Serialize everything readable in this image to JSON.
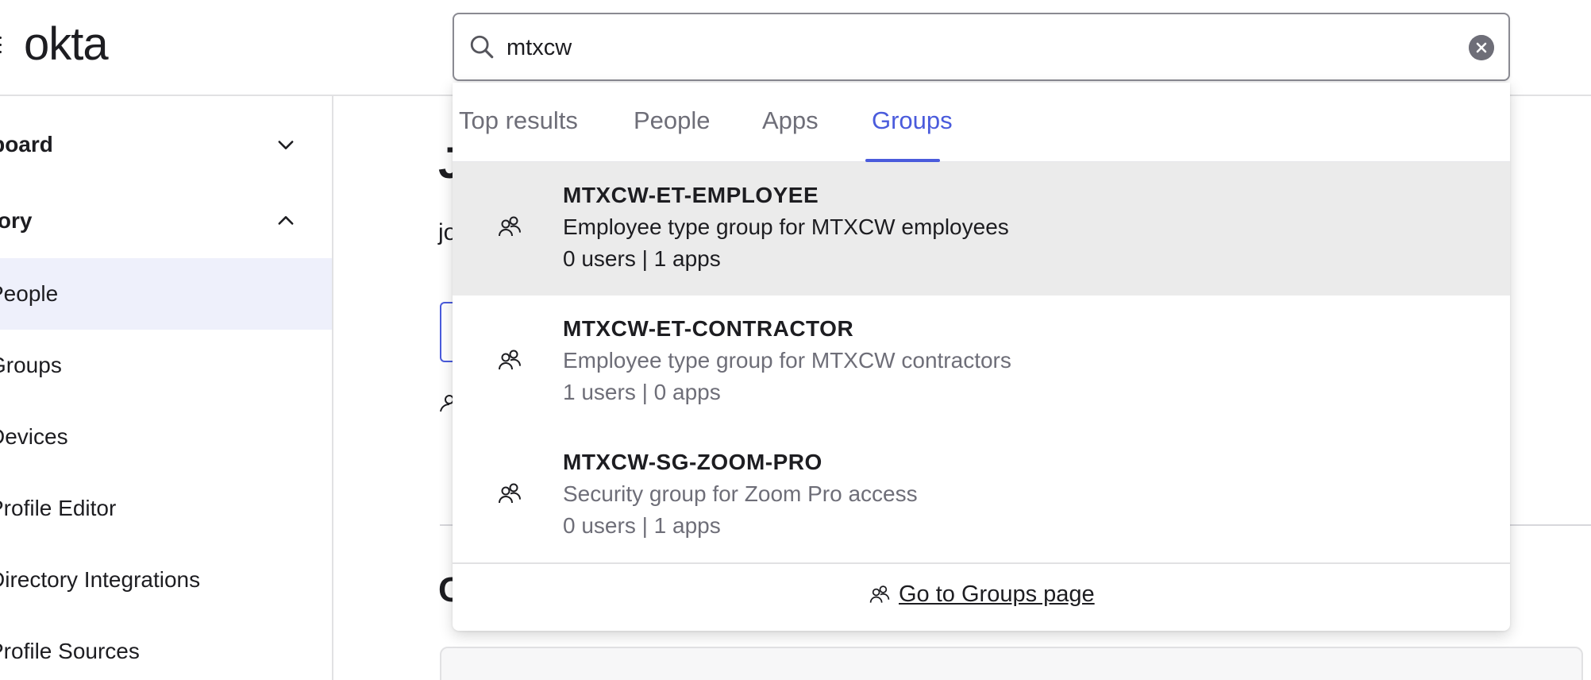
{
  "header": {
    "logo": "okta"
  },
  "sidebar": {
    "sections": [
      {
        "label": "nboard",
        "expanded": false
      },
      {
        "label": "ctory",
        "expanded": true
      }
    ],
    "items": [
      {
        "label": "People",
        "active": true
      },
      {
        "label": "Groups"
      },
      {
        "label": "Devices"
      },
      {
        "label": "Profile Editor"
      },
      {
        "label": "Directory Integrations"
      },
      {
        "label": "Profile Sources"
      }
    ]
  },
  "main": {
    "heading_fragment": "J",
    "sub_fragment": "jo",
    "section_fragment": "C"
  },
  "search": {
    "value": "mtxcw",
    "placeholder": ""
  },
  "tabs": [
    {
      "label": "Top results"
    },
    {
      "label": "People"
    },
    {
      "label": "Apps"
    },
    {
      "label": "Groups",
      "active": true
    }
  ],
  "results": [
    {
      "title": "MTXCW-ET-EMPLOYEE",
      "description": "Employee type group for MTXCW employees",
      "meta": "0 users | 1 apps"
    },
    {
      "title": "MTXCW-ET-CONTRACTOR",
      "description": "Employee type group for MTXCW contractors",
      "meta": "1 users | 0 apps"
    },
    {
      "title": "MTXCW-SG-ZOOM-PRO",
      "description": "Security group for Zoom Pro access",
      "meta": "0 users | 1 apps"
    }
  ],
  "footer": {
    "link_label": "Go to Groups page"
  },
  "colors": {
    "accent": "#4a5bdc",
    "active_nav_bg": "#eef0fb",
    "highlight_row": "#ebebeb"
  },
  "icons": [
    "menu-icon",
    "chevron-down-icon",
    "chevron-up-icon",
    "search-icon",
    "clear-icon",
    "group-icon"
  ]
}
